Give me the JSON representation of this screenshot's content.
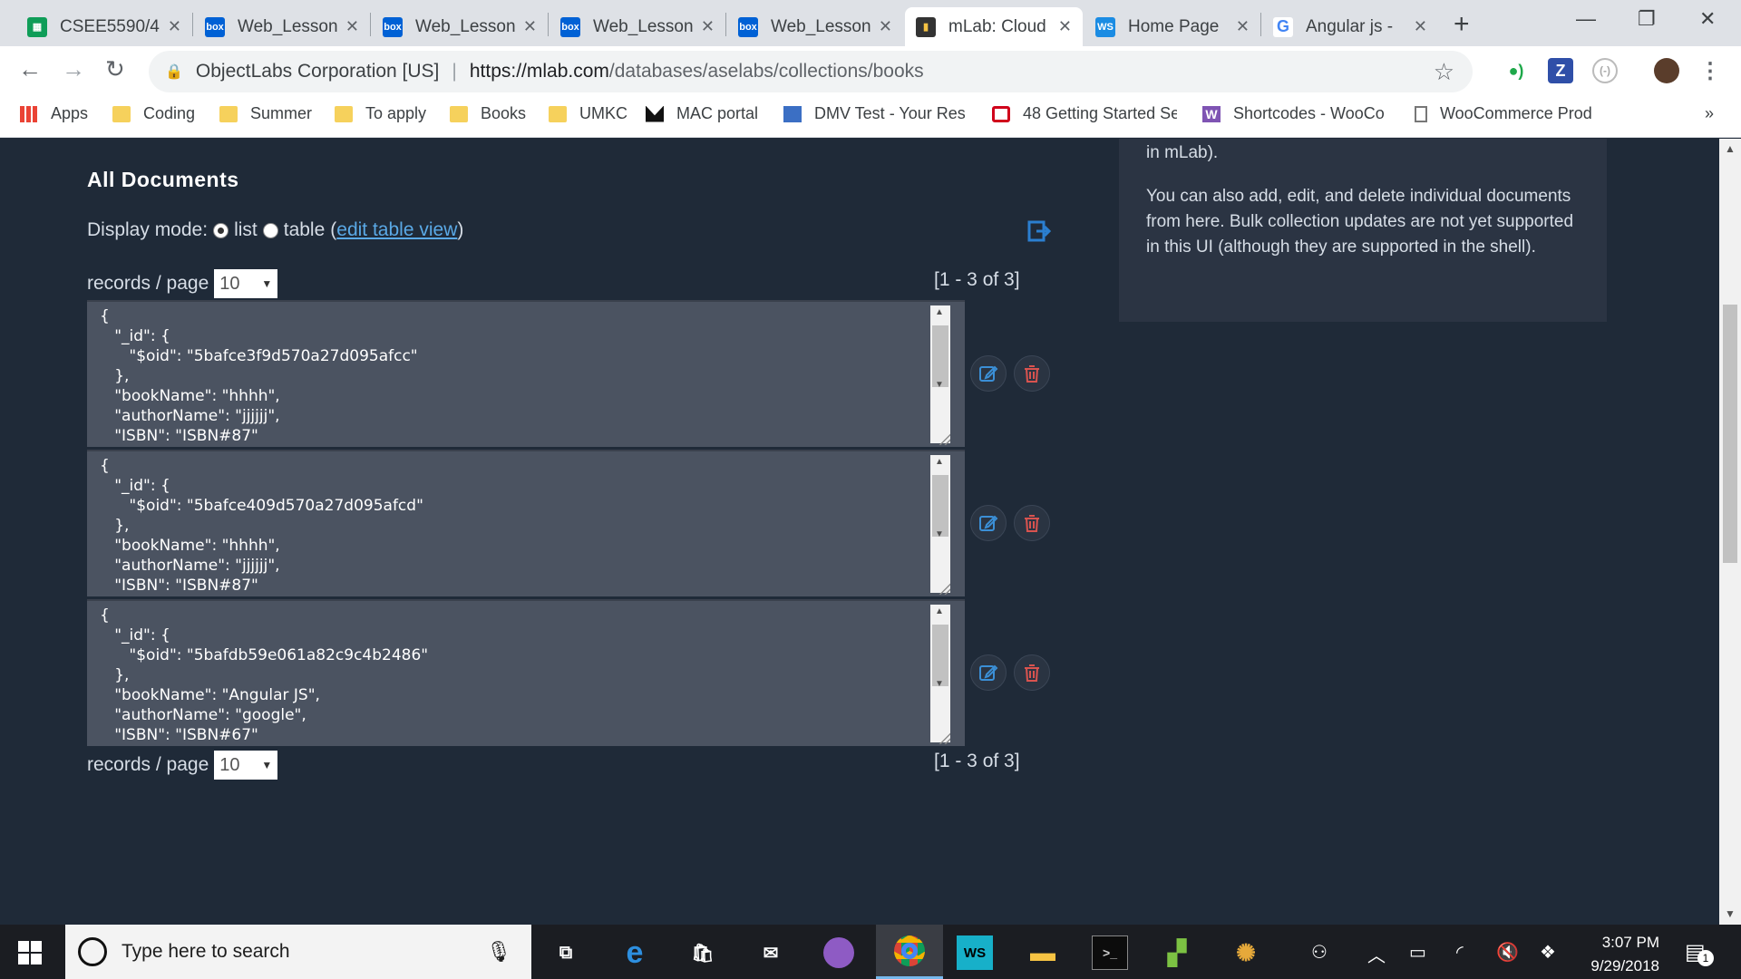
{
  "browser": {
    "tabs": [
      {
        "title": "CSEE5590/4",
        "favicon": "sheets-icon",
        "color": "#0f9d58",
        "active": false
      },
      {
        "title": "Web_Lesson",
        "favicon": "box-icon",
        "color": "#0061d5",
        "active": false
      },
      {
        "title": "Web_Lesson",
        "favicon": "box-icon",
        "color": "#0061d5",
        "active": false
      },
      {
        "title": "Web_Lesson",
        "favicon": "box-icon",
        "color": "#0061d5",
        "active": false
      },
      {
        "title": "Web_Lesson",
        "favicon": "box-icon",
        "color": "#0061d5",
        "active": false
      },
      {
        "title": "mLab: Cloud",
        "favicon": "mlab-icon",
        "color": "#333333",
        "active": true
      },
      {
        "title": "Home Page",
        "favicon": "webstorm-icon",
        "color": "#1b8ce3",
        "active": false
      },
      {
        "title": "Angular js -",
        "favicon": "google-icon",
        "color": "#4285f4",
        "active": false
      }
    ],
    "address": {
      "site_identity": "ObjectLabs Corporation [US]",
      "url_host": "https://mlab.com",
      "url_path": "/databases/aselabs/collections/books"
    },
    "bookmarks": [
      {
        "label": "Apps",
        "icon": "apps-grid-icon"
      },
      {
        "label": "Coding",
        "icon": "folder-icon"
      },
      {
        "label": "Summer",
        "icon": "folder-icon"
      },
      {
        "label": "To apply",
        "icon": "folder-icon"
      },
      {
        "label": "Books",
        "icon": "folder-icon"
      },
      {
        "label": "UMKC",
        "icon": "folder-icon"
      },
      {
        "label": "MAC portal",
        "icon": "mac-icon"
      },
      {
        "label": "DMV Test - Your Res",
        "icon": "dmv-icon"
      },
      {
        "label": "48 Getting Started Se",
        "icon": "oracle-icon"
      },
      {
        "label": "Shortcodes - WooCo",
        "icon": "woo-icon"
      },
      {
        "label": "WooCommerce Prod",
        "icon": "page-icon"
      }
    ],
    "bookmarks_overflow": "»"
  },
  "page": {
    "heading": "All Documents",
    "display_mode": {
      "label": "Display mode:",
      "list": "list",
      "table": "table",
      "open_paren": "(",
      "edit_link": "edit table view",
      "close_paren": ")",
      "selected": "list"
    },
    "pagination_top": {
      "label": "records / page",
      "value": "10",
      "range": "[1 - 3 of 3]"
    },
    "pagination_bottom": {
      "label": "records / page",
      "value": "10",
      "range": "[1 - 3 of 3]"
    },
    "documents": [
      {
        "text": "{\n   \"_id\": {\n      \"$oid\": \"5bafce3f9d570a27d095afcc\"\n   },\n   \"bookName\": \"hhhh\",\n   \"authorName\": \"jjjjjj\",\n   \"ISBN\": \"ISBN#87\""
      },
      {
        "text": "{\n   \"_id\": {\n      \"$oid\": \"5bafce409d570a27d095afcd\"\n   },\n   \"bookName\": \"hhhh\",\n   \"authorName\": \"jjjjjj\",\n   \"ISBN\": \"ISBN#87\""
      },
      {
        "text": "{\n   \"_id\": {\n      \"$oid\": \"5bafdb59e061a82c9c4b2486\"\n   },\n   \"bookName\": \"Angular JS\",\n   \"authorName\": \"google\",\n   \"ISBN\": \"ISBN#67\""
      }
    ],
    "side_panel": {
      "line1": "in mLab).",
      "line2": "You can also add, edit, and delete individual documents from here. Bulk collection updates are not yet supported in this UI (although they are supported in the shell)."
    }
  },
  "taskbar": {
    "search_placeholder": "Type here to search",
    "time": "3:07 PM",
    "date": "9/29/2018",
    "notification_count": "1"
  },
  "colors": {
    "page_bg": "#1f2a38",
    "doc_bg": "#4b5361",
    "edit_blue": "#3b8fd6",
    "delete_red": "#d9534f",
    "link_blue": "#5aa9e6"
  }
}
